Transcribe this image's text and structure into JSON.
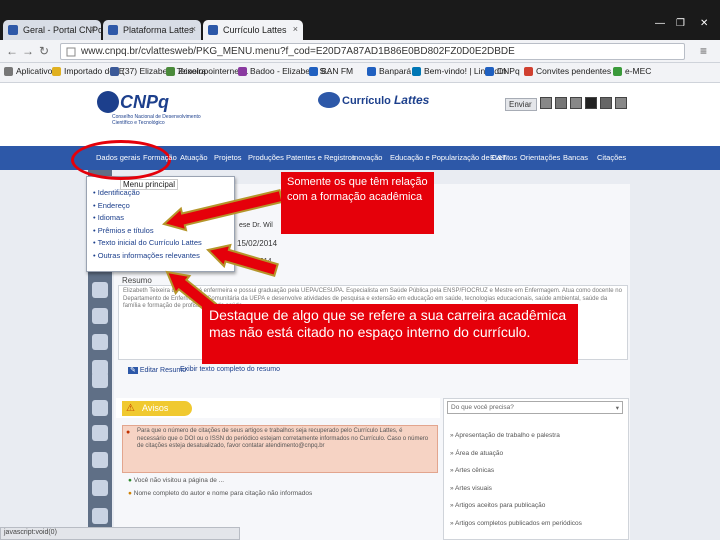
{
  "browser": {
    "tabs": [
      {
        "label": "Geral - Portal CNPq",
        "color": "#2d58a8"
      },
      {
        "label": "Plataforma Lattes",
        "color": "#2d58a8"
      },
      {
        "label": "Currículo Lattes",
        "color": "#2d58a8"
      }
    ],
    "url": "www.cnpq.br/cvlattesweb/PKG_MENU.menu?f_cod=E20D7A87AD1B86E0BD802FZ0D0E2DBDE",
    "bookmarks": [
      {
        "label": "Aplicativos",
        "color": "#777777"
      },
      {
        "label": "Importado do IE",
        "color": "#e0b020"
      },
      {
        "label": "(37) Elizabeth Teixeira",
        "color": "#3b5998"
      },
      {
        "label": "Zcoolopointerner...",
        "color": "#4a8a3a"
      },
      {
        "label": "Badoo - Elizabeth S...",
        "color": "#8a3aa0"
      },
      {
        "label": "BAN FM",
        "color": "#2060c0"
      },
      {
        "label": "Banpará",
        "color": "#2060c0"
      },
      {
        "label": "Bem-vindo! | LinkedIn",
        "color": "#0077b5"
      },
      {
        "label": "CNPq",
        "color": "#2060c0"
      },
      {
        "label": "Convites pendentes",
        "color": "#d04030"
      },
      {
        "label": "e-MEC",
        "color": "#3a9a3a"
      }
    ]
  },
  "site": {
    "logo": "CNPq",
    "logo_sub": "Conselho Nacional de Desenvolvimento Científico e Tecnológico",
    "product": "Currículo",
    "product_b": "Lattes",
    "toolbar": {
      "send": "Enviar"
    },
    "nav": [
      "Dados gerais",
      "Formação",
      "Atuação",
      "Projetos",
      "Produções",
      "Patentes e Registros",
      "Inovação",
      "Educação e Popularização de C&T",
      "Eventos",
      "Orientações",
      "Bancas",
      "Citações"
    ]
  },
  "menu": {
    "title": "Menu principal",
    "items": [
      "Identificação",
      "Endereço",
      "Idiomas",
      "Prêmios e títulos",
      "Texto inicial do Currículo Lattes",
      "Outras informações relevantes"
    ]
  },
  "content": {
    "peek_1": "eira",
    "peek_2": "ese Dr. Wil",
    "date_1": "15/02/2014",
    "date_2": "/2014",
    "resumo_title": "Resumo",
    "resumo_text": "Elizabeth Teixeira de Souza é enfermeira e possui graduação pela UEPA/CESUPA. Especialista em Saúde Pública pela ENSP/FIOCRUZ e Mestre em Enfermagem. Atua como docente no Departamento de Enfermagem Comunitária da UEPA e desenvolve atividades de pesquisa e extensão em educação em saúde, tecnologias educacionais, saúde ambiental, saúde da família e formação de profissionais de saúde.",
    "edit_resumo": "Editar Resumo",
    "edit_text": "Exibir texto completo do resumo",
    "avisos": "Avisos",
    "alert_text": "Para que o número de citações de seus artigos e trabalhos seja recuperado pelo Currículo Lattes, é necessário que o DOI ou o ISSN do periódico estejam corretamente informados no Currículo. Caso o número de citações esteja desatualizado, favor contatar atendimento@cnpq.br",
    "alert_row1": "Você não visitou a página de ...",
    "alert_row2": "Nome completo do autor e nome para citação não informados",
    "right_select": "Do que você precisa?",
    "right_items": [
      "Apresentação de trabalho e palestra",
      "Área de atuação",
      "Artes cênicas",
      "Artes visuais",
      "Artigos aceitos para publicação",
      "Artigos completos publicados em periódicos"
    ]
  },
  "status": "javascript:void(0)",
  "annotations": {
    "top": "Somente os que têm relação com a formação acadêmica",
    "bottom": "Destaque de algo que se refere a sua carreira acadêmica mas não está citado no espaço interno do currículo."
  },
  "colors": {
    "accent_red": "#e5000a",
    "nav_blue": "#2d58a8",
    "arrow": "#b5952a",
    "alert": "#f0c930"
  }
}
